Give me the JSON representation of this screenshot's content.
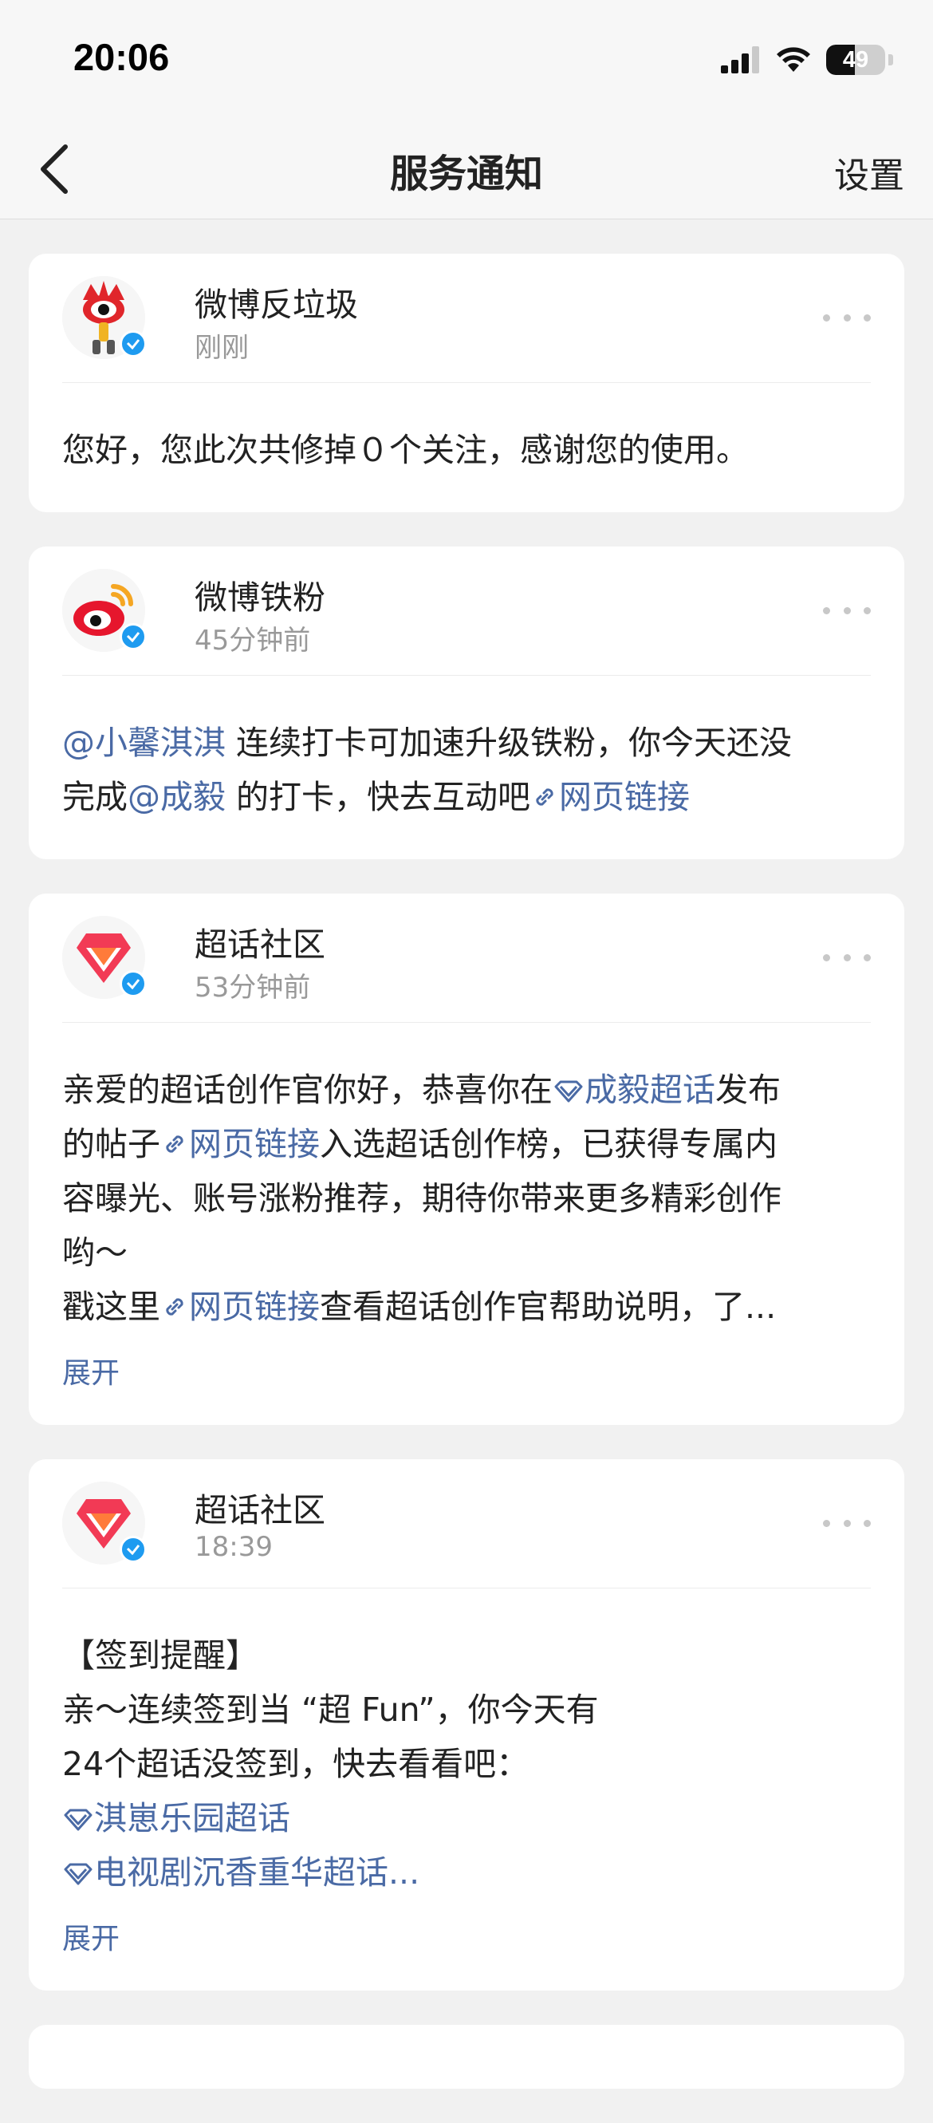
{
  "status_bar": {
    "time": "20:06",
    "battery": "49",
    "battery_level": 0.49
  },
  "nav": {
    "title": "服务通知",
    "settings_label": "设置"
  },
  "cards": [
    {
      "sender": "微博反垃圾",
      "time": "刚刚",
      "body": "您好，您此次共修掉０个关注，感谢您的使用。"
    },
    {
      "sender": "微博铁粉",
      "time": "45分钟前",
      "mention1": "@小馨淇淇",
      "text1": " 连续打卡可加速升级铁粉，你今天还没",
      "text2": "完成",
      "mention2": "@成毅",
      "text3": " 的打卡，快去互动吧",
      "link": "网页链接"
    },
    {
      "sender": "超话社区",
      "time": "53分钟前",
      "text1": "亲爱的超话创作官你好，恭喜你在",
      "topic": "成毅超话",
      "text2": "发布",
      "text3": "的帖子",
      "link1": "网页链接",
      "text4": "入选超话创作榜，已获得专属内",
      "text5": "容曝光、账号涨粉推荐，期待你带来更多精彩创作",
      "text6": "哟～",
      "text7": "戳这里",
      "link2": "网页链接",
      "text8": "查看超话创作官帮助说明，了...",
      "expand": "展开"
    },
    {
      "sender": "超话社区",
      "time": "18:39",
      "line1": "【签到提醒】",
      "line2": "亲～连续签到当 “超 Fun”，你今天有",
      "line3": "24个超话没签到，快去看看吧：",
      "topic1": "淇崽乐园超话",
      "topic2": "电视剧沉香重华超话...",
      "expand": "展开"
    }
  ],
  "colors": {
    "link": "#4a6aa5",
    "verified": "#1e9bf0",
    "background": "#f1f1f1"
  }
}
